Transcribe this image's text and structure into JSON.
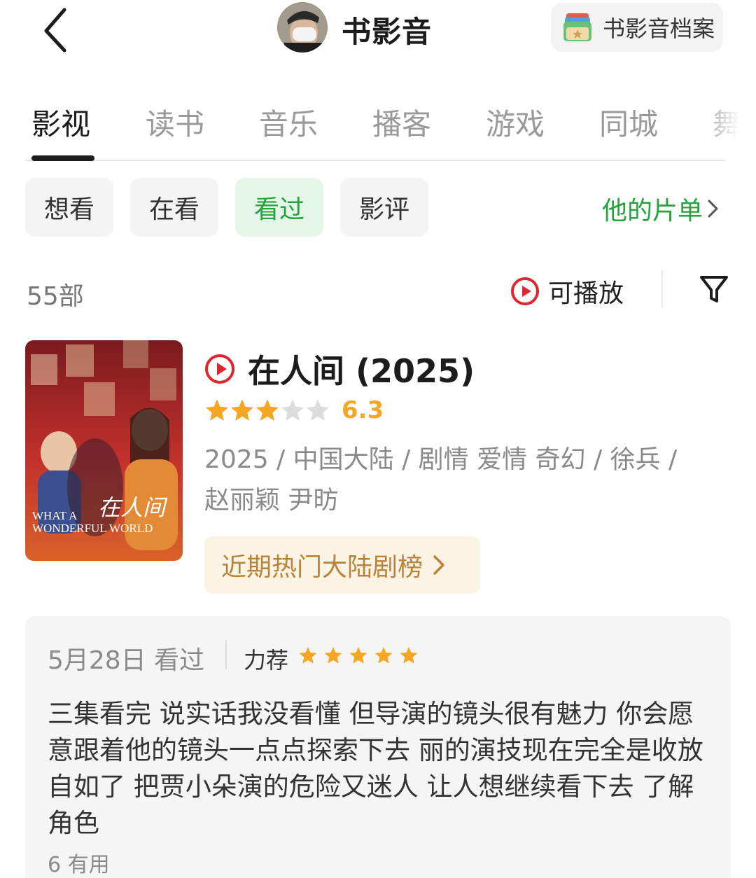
{
  "header": {
    "title": "书影音",
    "archive_label": "书影音档案"
  },
  "tabs": [
    {
      "label": "影视",
      "active": true
    },
    {
      "label": "读书"
    },
    {
      "label": "音乐"
    },
    {
      "label": "播客"
    },
    {
      "label": "游戏"
    },
    {
      "label": "同城"
    },
    {
      "label": "舞"
    }
  ],
  "chips": [
    {
      "label": "想看"
    },
    {
      "label": "在看"
    },
    {
      "label": "看过",
      "selected": true
    },
    {
      "label": "影评"
    }
  ],
  "film_list_link": "他的片单",
  "count": "55部",
  "playable_label": "可播放",
  "movie": {
    "title": "在人间 (2025)",
    "rating_value": 3,
    "rating_max": 5,
    "score": "6.3",
    "meta_line1": "2025 / 中国大陆 / 剧情 爱情 奇幻 / 徐兵 /",
    "meta_line2": "赵丽颖 尹昉",
    "poster": {
      "calligraphy": "在人间",
      "en_line1": "WHAT A",
      "en_line2": "WONDERFUL WORLD"
    },
    "rank_label": "近期热门大陆剧榜"
  },
  "review": {
    "date": "5月28日 看过",
    "tag": "力荐",
    "stars": 5,
    "text": "三集看完 说实话我没看懂 但导演的镜头很有魅力 你会愿意跟着他的镜头一点点探索下去 丽的演技现在完全是收放自如了 把贾小朵演的危险又迷人 让人想继续看下去 了解角色",
    "useful": "6 有用"
  },
  "colors": {
    "accent_green": "#24a33c",
    "star_orange": "#f5a623",
    "play_red": "#e0262d",
    "rank_brown": "#b8833a"
  }
}
